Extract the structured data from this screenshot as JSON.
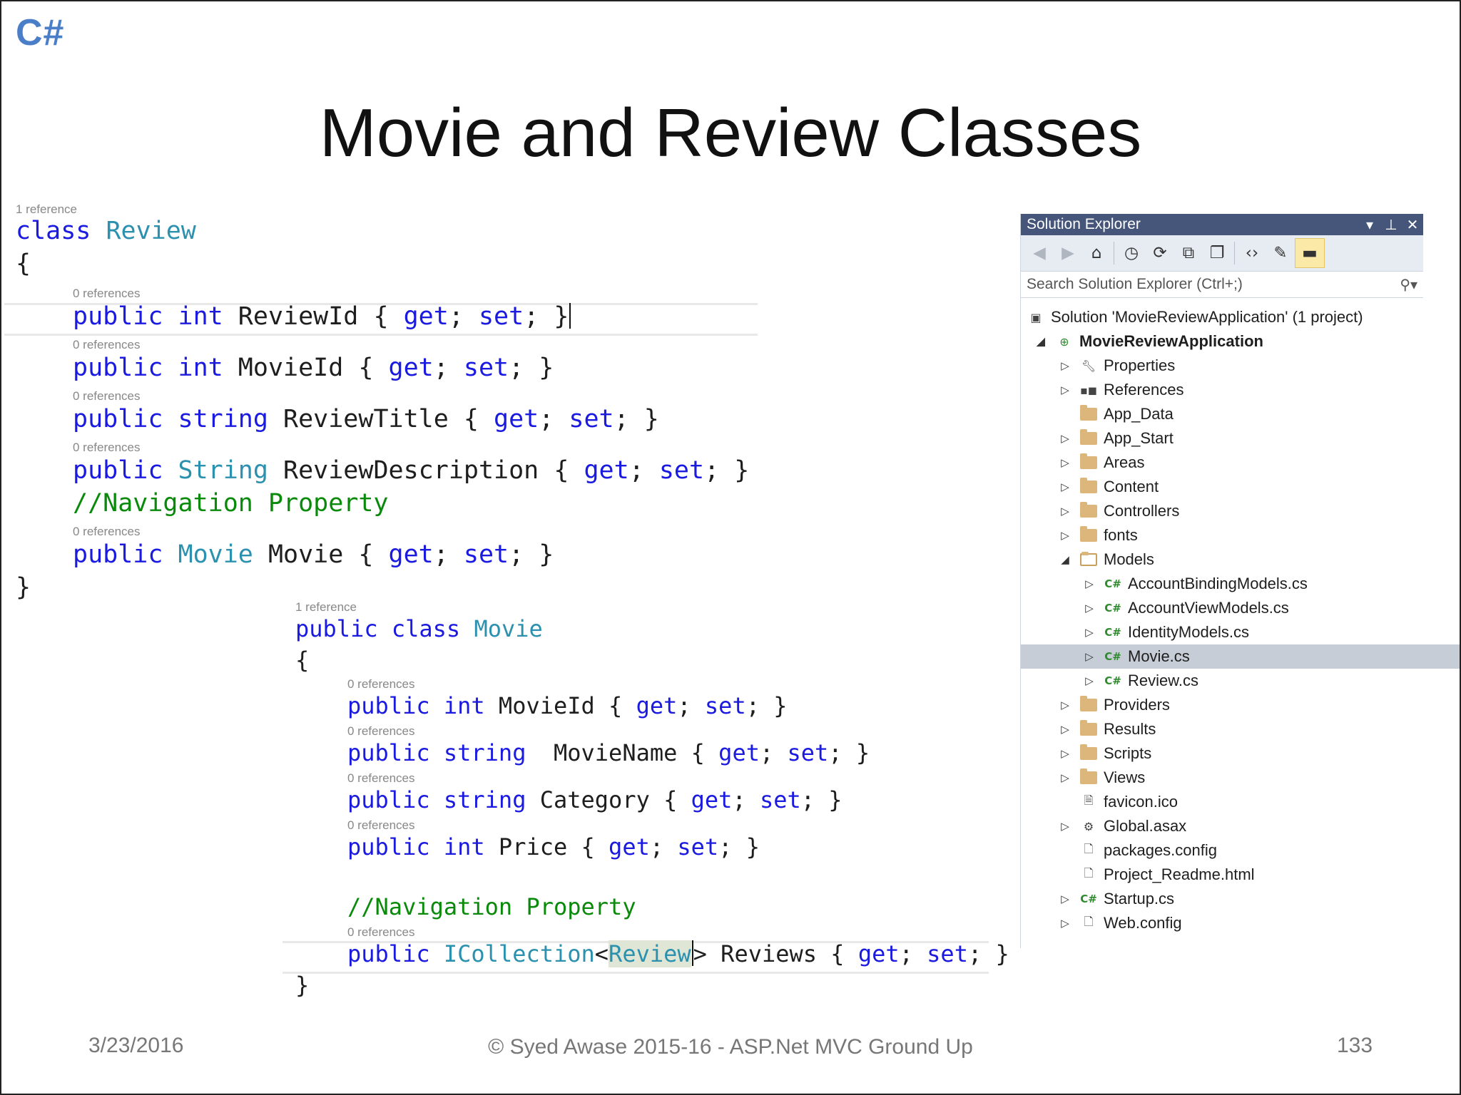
{
  "slide": {
    "logo": "C#",
    "title": "Movie and Review Classes",
    "footer": {
      "date": "3/23/2016",
      "copyright": "© Syed Awase 2015-16 - ASP.Net MVC Ground Up",
      "page": "133"
    }
  },
  "review_code": {
    "class_ref": "1 reference",
    "kw_class": "class",
    "class_name": "Review",
    "open_brace": "{",
    "close_brace": "}",
    "refs": [
      "0 references",
      "0 references",
      "0 references",
      "0 references",
      "0 references"
    ],
    "comment": "//Navigation Property",
    "props": [
      {
        "mod": "public",
        "type": "int",
        "rest": " ReviewId { ",
        "get": "get",
        "semi1": "; ",
        "set": "set",
        "semi2": "; }"
      },
      {
        "mod": "public",
        "type": "int",
        "rest": " MovieId { ",
        "get": "get",
        "semi1": "; ",
        "set": "set",
        "semi2": "; }"
      },
      {
        "mod": "public",
        "type": "string",
        "rest": " ReviewTitle { ",
        "get": "get",
        "semi1": "; ",
        "set": "set",
        "semi2": "; }"
      },
      {
        "mod": "public",
        "type": "String",
        "rest": " ReviewDescription { ",
        "get": "get",
        "semi1": "; ",
        "set": "set",
        "semi2": "; }"
      },
      {
        "mod": "public",
        "type": "Movie",
        "rest": " Movie { ",
        "get": "get",
        "semi1": "; ",
        "set": "set",
        "semi2": "; }"
      }
    ]
  },
  "movie_code": {
    "class_ref": "1 reference",
    "kw_public": "public",
    "kw_class": "class",
    "class_name": "Movie",
    "open_brace": "{",
    "close_brace": "}",
    "refs": [
      "0 references",
      "0 references",
      "0 references",
      "0 references",
      "0 references"
    ],
    "comment": "//Navigation Property",
    "props": [
      {
        "mod": "public",
        "type": "int",
        "rest": " MovieId { ",
        "get": "get",
        "semi1": "; ",
        "set": "set",
        "semi2": "; }"
      },
      {
        "mod": "public",
        "type": "string",
        "rest": "  MovieName { ",
        "get": "get",
        "semi1": "; ",
        "set": "set",
        "semi2": "; }"
      },
      {
        "mod": "public",
        "type": "string",
        "rest": " Category { ",
        "get": "get",
        "semi1": "; ",
        "set": "set",
        "semi2": "; }"
      },
      {
        "mod": "public",
        "type": "int",
        "rest": " Price { ",
        "get": "get",
        "semi1": "; ",
        "set": "set",
        "semi2": "; }"
      }
    ],
    "nav_prop": {
      "mod": "public",
      "type": "ICollection",
      "lt": "<",
      "generic": "Review",
      "gt": ">",
      "rest": " Reviews { ",
      "get": "get",
      "semi1": "; ",
      "set": "set",
      "semi2": "; }"
    }
  },
  "solution_explorer": {
    "title": "Solution Explorer",
    "search_placeholder": "Search Solution Explorer (Ctrl+;)",
    "header_buttons": [
      "dropdown-icon",
      "pin-icon",
      "close-icon"
    ],
    "toolbar_icons": [
      "back-icon",
      "forward-icon",
      "home-icon",
      "history-icon",
      "sync-icon",
      "collapse-all-icon",
      "show-all-files-icon",
      "view-code-icon",
      "properties-wrench-icon",
      "preview-selected-icon"
    ],
    "items": [
      {
        "label": "Solution 'MovieReviewApplication' (1 project)",
        "icon": "solution-icon"
      },
      {
        "label": "MovieReviewApplication",
        "icon": "web-project-icon"
      },
      {
        "label": "Properties",
        "icon": "wrench-icon"
      },
      {
        "label": "References",
        "icon": "references-icon"
      },
      {
        "label": "App_Data",
        "icon": "folder-icon"
      },
      {
        "label": "App_Start",
        "icon": "folder-icon"
      },
      {
        "label": "Areas",
        "icon": "folder-icon"
      },
      {
        "label": "Content",
        "icon": "folder-icon"
      },
      {
        "label": "Controllers",
        "icon": "folder-icon"
      },
      {
        "label": "fonts",
        "icon": "folder-icon"
      },
      {
        "label": "Models",
        "icon": "folder-open-icon"
      },
      {
        "label": "AccountBindingModels.cs",
        "icon": "csharp-file-icon"
      },
      {
        "label": "AccountViewModels.cs",
        "icon": "csharp-file-icon"
      },
      {
        "label": "IdentityModels.cs",
        "icon": "csharp-file-icon"
      },
      {
        "label": "Movie.cs",
        "icon": "csharp-file-icon"
      },
      {
        "label": "Review.cs",
        "icon": "csharp-file-icon"
      },
      {
        "label": "Providers",
        "icon": "folder-icon"
      },
      {
        "label": "Results",
        "icon": "folder-icon"
      },
      {
        "label": "Scripts",
        "icon": "folder-icon"
      },
      {
        "label": "Views",
        "icon": "folder-icon"
      },
      {
        "label": "favicon.ico",
        "icon": "image-file-icon"
      },
      {
        "label": "Global.asax",
        "icon": "asax-file-icon"
      },
      {
        "label": "packages.config",
        "icon": "config-file-icon"
      },
      {
        "label": "Project_Readme.html",
        "icon": "html-file-icon"
      },
      {
        "label": "Startup.cs",
        "icon": "csharp-file-icon"
      },
      {
        "label": "Web.config",
        "icon": "config-file-icon"
      }
    ],
    "selected": "Movie.cs",
    "colors": {
      "header": "#45567a",
      "toolbar": "#e7ecf3",
      "selection": "#c7cdd6",
      "folder": "#dcb67a"
    }
  },
  "colors": {
    "keyword": "#1a1ae0",
    "type": "#2b91af",
    "comment": "#0a8a0a",
    "logo": "#4a7ec8"
  }
}
